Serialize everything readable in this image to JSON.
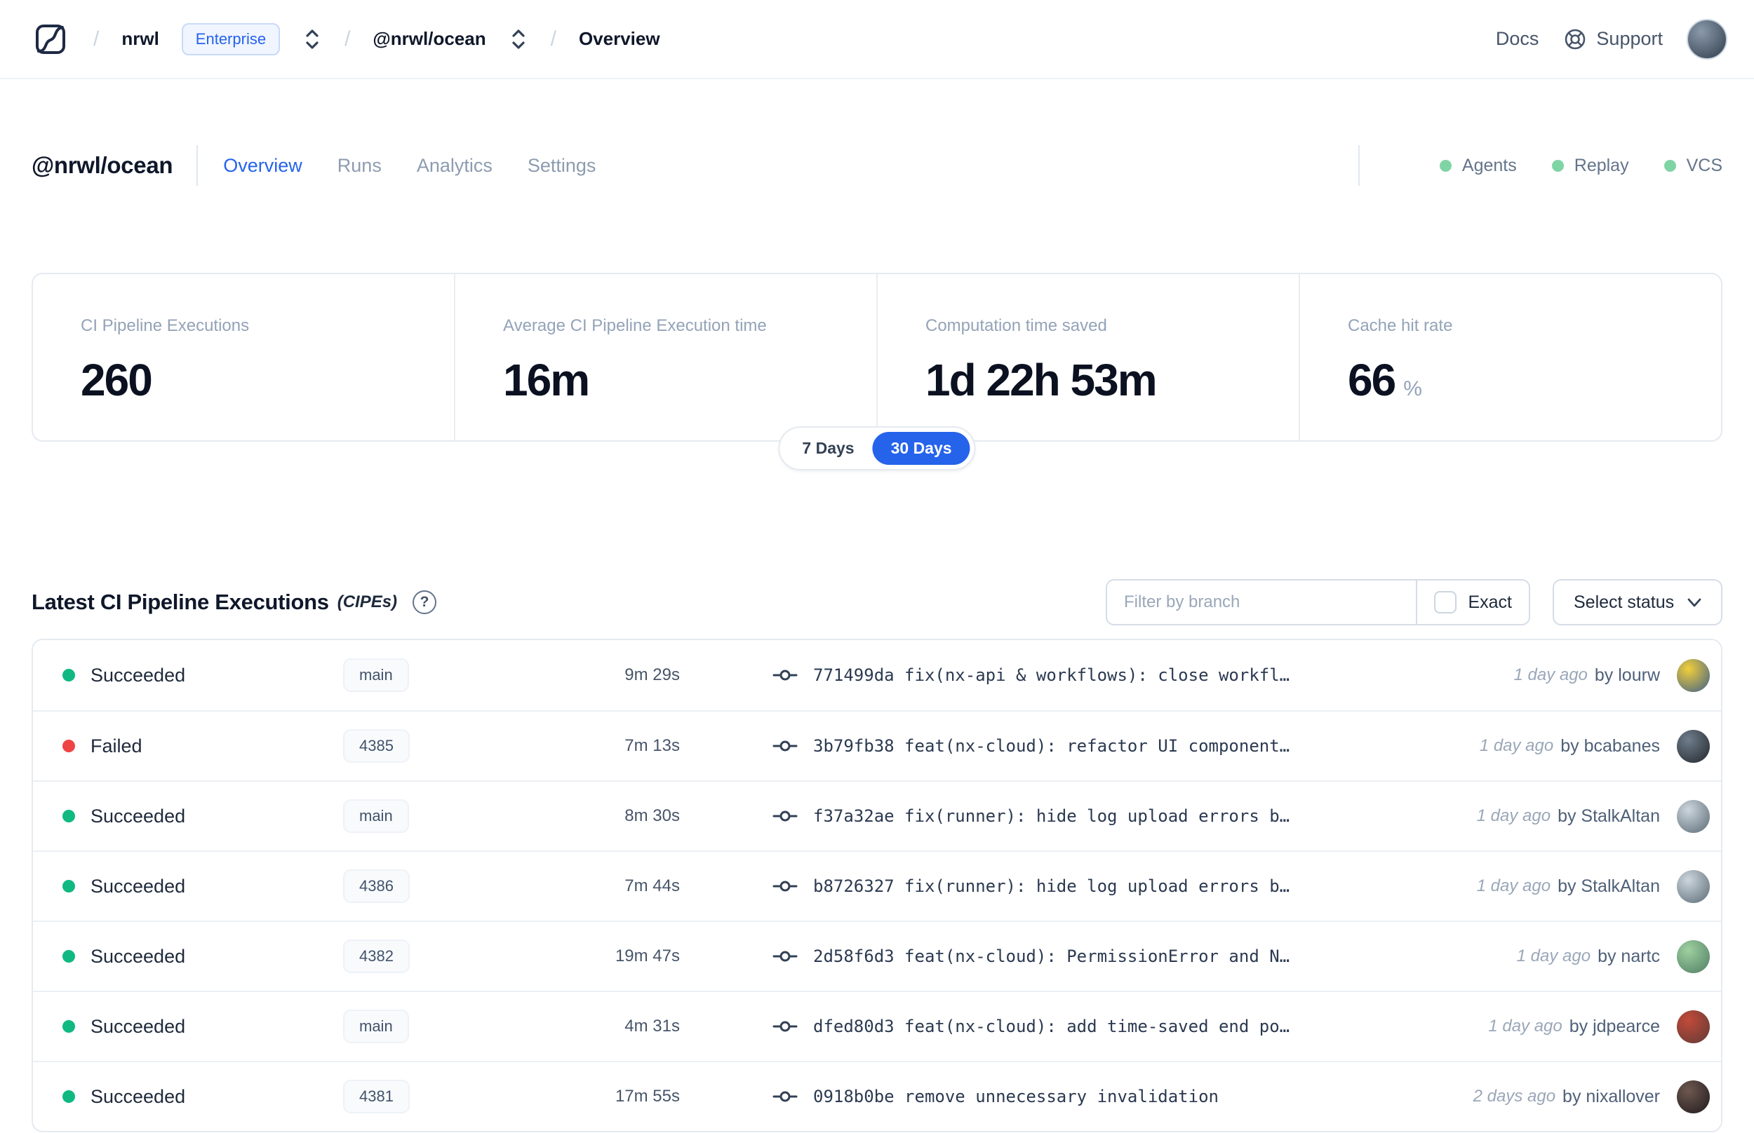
{
  "colors": {
    "accent_blue": "#2563eb",
    "status": {
      "succeeded": "#10b981",
      "failed": "#ef4444"
    },
    "soft_green": "#7fd4a4"
  },
  "navbar": {
    "logo": "nx-cloud-logo",
    "org": "nrwl",
    "org_badge": "Enterprise",
    "workspace": "@nrwl/ocean",
    "page": "Overview",
    "docs": "Docs",
    "support": "Support",
    "avatar_colors": [
      "#8b9aab",
      "#2e3b4a"
    ]
  },
  "header": {
    "title": "@nrwl/ocean",
    "tabs": [
      {
        "label": "Overview",
        "active": true
      },
      {
        "label": "Runs",
        "active": false
      },
      {
        "label": "Analytics",
        "active": false
      },
      {
        "label": "Settings",
        "active": false
      }
    ],
    "statuses": [
      {
        "label": "Agents"
      },
      {
        "label": "Replay"
      },
      {
        "label": "VCS"
      }
    ]
  },
  "stats": {
    "cards": [
      {
        "label": "CI Pipeline Executions",
        "value": "260",
        "suffix": ""
      },
      {
        "label": "Average CI Pipeline Execution time",
        "value": "16m",
        "suffix": ""
      },
      {
        "label": "Computation time saved",
        "value": "1d 22h 53m",
        "suffix": ""
      },
      {
        "label": "Cache hit rate",
        "value": "66",
        "suffix": "%"
      }
    ],
    "range": {
      "options": [
        "7 Days",
        "30 Days"
      ],
      "selected": "30 Days"
    }
  },
  "cipe": {
    "title": "Latest CI Pipeline Executions",
    "subtitle": "(CIPEs)",
    "help_glyph": "?",
    "filter_placeholder": "Filter by branch",
    "exact_label": "Exact",
    "select_status_label": "Select status"
  },
  "table": {
    "rows": [
      {
        "status": "Succeeded",
        "status_color": "succeeded",
        "branch": "main",
        "duration": "9m 29s",
        "commit": "771499da fix(nx-api & workflows): close workfl…",
        "time": "1 day ago",
        "author": "by lourw",
        "avatar_colors": [
          "#f2cf3a",
          "#3e5f8a"
        ]
      },
      {
        "status": "Failed",
        "status_color": "failed",
        "branch": "4385",
        "duration": "7m 13s",
        "commit": "3b79fb38 feat(nx-cloud): refactor UI component…",
        "time": "1 day ago",
        "author": "by bcabanes",
        "avatar_colors": [
          "#6f7d8c",
          "#23272c"
        ]
      },
      {
        "status": "Succeeded",
        "status_color": "succeeded",
        "branch": "main",
        "duration": "8m 30s",
        "commit": "f37a32ae fix(runner): hide log upload errors b…",
        "time": "1 day ago",
        "author": "by StalkAltan",
        "avatar_colors": [
          "#cdd6dd",
          "#5a6a75"
        ]
      },
      {
        "status": "Succeeded",
        "status_color": "succeeded",
        "branch": "4386",
        "duration": "7m 44s",
        "commit": "b8726327 fix(runner): hide log upload errors b…",
        "time": "1 day ago",
        "author": "by StalkAltan",
        "avatar_colors": [
          "#cdd6dd",
          "#5a6a75"
        ]
      },
      {
        "status": "Succeeded",
        "status_color": "succeeded",
        "branch": "4382",
        "duration": "19m 47s",
        "commit": "2d58f6d3 feat(nx-cloud): PermissionError and N…",
        "time": "1 day ago",
        "author": "by nartc",
        "avatar_colors": [
          "#9fd0a0",
          "#4e7d62"
        ]
      },
      {
        "status": "Succeeded",
        "status_color": "succeeded",
        "branch": "main",
        "duration": "4m 31s",
        "commit": "dfed80d3 feat(nx-cloud): add time-saved end po…",
        "time": "1 day ago",
        "author": "by jdpearce",
        "avatar_colors": [
          "#c24a3a",
          "#5f3b35"
        ]
      },
      {
        "status": "Succeeded",
        "status_color": "succeeded",
        "branch": "4381",
        "duration": "17m 55s",
        "commit": "0918b0be remove unnecessary invalidation",
        "time": "2 days ago",
        "author": "by nixallover",
        "avatar_colors": [
          "#6e5850",
          "#201a1d"
        ]
      }
    ]
  }
}
